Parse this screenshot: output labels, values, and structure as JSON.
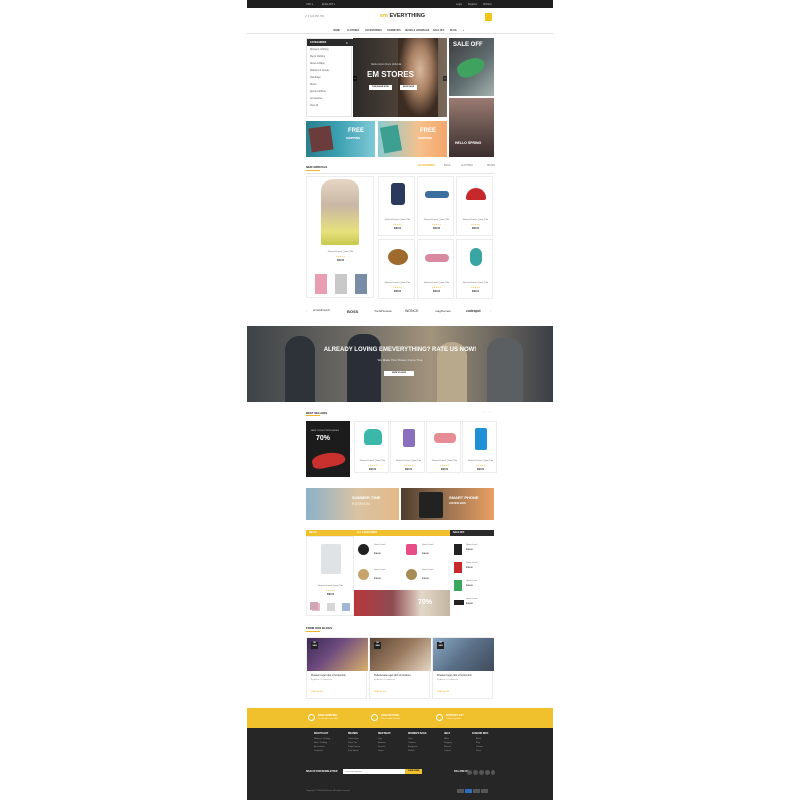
{
  "topbar": {
    "left": [
      "USD ▾",
      "ENGLISH ▾"
    ],
    "right": [
      "Login",
      "Register",
      "Wishlist"
    ]
  },
  "header": {
    "phone": "✆ 0 123 456 789",
    "logo_mark": "em",
    "logo_text": "EVERYTHING"
  },
  "nav": {
    "items": [
      "HOME",
      "CLOTHING",
      "ACCESSORIES",
      "COSMETICS",
      "SHOES & HANDBAGS",
      "SALE OFF",
      "BLOG"
    ]
  },
  "categories": {
    "header": "CATEGORIES",
    "items": [
      "Women's Clothing",
      "Men's Clothing",
      "Shoes & Bags",
      "Watches & Jewelry",
      "Handbags",
      "Shoes",
      "Sports Clothing",
      "Accessories",
      "View All"
    ]
  },
  "hero": {
    "subtitle": "Nulla rutrum Nunc Vehicula",
    "title": "EM STORES",
    "btn1": "PURCHASE NOW",
    "btn2": "SHOP NOW"
  },
  "sale_banner": {
    "title": "SALE OFF"
  },
  "man_banner": {
    "title": "HELLO SPRING"
  },
  "free_banners": [
    {
      "title": "FREE",
      "subtitle": "SHIPPING"
    },
    {
      "title": "FREE",
      "subtitle": "SHIPPING"
    }
  ],
  "new_arrivals": {
    "title": "NEW ARRIVALS",
    "tabs": [
      "ACCESSORIES",
      "BAGS",
      "CLOTHING",
      "SHOES"
    ],
    "featured": {
      "name": "Nostrud Lunch Quam Title",
      "price": "$38.00"
    },
    "products": [
      {
        "name": "Nostrud Lunch Quam Title",
        "price": "$38.00"
      },
      {
        "name": "Nostrud Lunch Quam Title",
        "price": "$38.00"
      },
      {
        "name": "Nostrud Lunch Quam Title",
        "price": "$38.00"
      },
      {
        "name": "Nostrud Lunch Quam Title",
        "price": "$38.00"
      },
      {
        "name": "Nostrud Lunch Quam Title",
        "price": "$38.00"
      },
      {
        "name": "Nostrud Lunch Quam Title",
        "price": "$38.00"
      }
    ]
  },
  "brands": [
    "arrows&rounds",
    "BOSS",
    "TrendSenses",
    "WONCE",
    "magthemes",
    "codespot"
  ],
  "rate_banner": {
    "title": "ALREADY LOVING EMEVERYTHING? RATE US NOW!",
    "subtitle": "We Make Your Dream Come True",
    "button": "RATE US NOW"
  },
  "best_sellers": {
    "title": "BEST SELLERS",
    "promo_text": "NEW COLLECTION SHOES",
    "promo_pct": "70%",
    "products": [
      {
        "name": "Nostrud Lunch Quam Title",
        "price": "$38.00"
      },
      {
        "name": "Nostrud Lunch Quam Title",
        "price": "$38.00"
      },
      {
        "name": "Nostrud Lunch Quam Title",
        "price": "$38.00"
      },
      {
        "name": "Nostrud Lunch Quam Title",
        "price": "$38.00"
      }
    ]
  },
  "mid_banners": [
    {
      "title": "SUMMER TIME",
      "subtitle": "FASHION"
    },
    {
      "title": "SMART PHONE",
      "subtitle": "COVER BOX"
    }
  ],
  "deals": {
    "tab1": "DEALS",
    "tab2": "ALL CATEGORIES",
    "tab3": "SALE OFF",
    "featured": {
      "name": "Nostrud Lunch Quam Title",
      "price": "$38.00"
    },
    "grid": [
      {
        "name": "Quam Lunch",
        "price": "$38.00"
      },
      {
        "name": "Quam Lunch",
        "price": "$38.00"
      },
      {
        "name": "Quam Lunch",
        "price": "$38.00"
      },
      {
        "name": "Quam Lunch",
        "price": "$38.00"
      }
    ],
    "sale_banner_pct": "70%",
    "sale_list": [
      {
        "name": "Quam Lunch",
        "price": "$38.00"
      },
      {
        "name": "Quam Lunch",
        "price": "$38.00"
      },
      {
        "name": "Quam Lunch",
        "price": "$38.00"
      },
      {
        "name": "Quam Lunch",
        "price": "$38.00"
      }
    ]
  },
  "blog": {
    "title": "FROM OUR BLOGS",
    "posts": [
      {
        "day": "26",
        "mon": "JAN",
        "title": "Praesent eget odio ut fermentum",
        "by": "By Admin / 0 comments",
        "more": "READ MORE"
      },
      {
        "day": "26",
        "mon": "JAN",
        "title": "Pellentesque eget nibh ut tincidunt",
        "by": "By Admin / 0 comments",
        "more": "READ MORE"
      },
      {
        "day": "26",
        "mon": "JAN",
        "title": "Praesent eget odio ut fermentum",
        "by": "By Admin / 0 comments",
        "more": "READ MORE"
      }
    ]
  },
  "services": [
    {
      "title": "FREE SHIPPING",
      "sub": "On all orders over $99"
    },
    {
      "title": "FREE RETURN",
      "sub": "Return within 30 days"
    },
    {
      "title": "SUPPORT 24/7",
      "sub": "Call us any time"
    }
  ],
  "footer": {
    "columns": [
      {
        "title": "WHAT'S HOT",
        "items": [
          "Women's Clothing",
          "Men's Clothing",
          "Accessories",
          "Cosmetics"
        ]
      },
      {
        "title": "BRANDS",
        "items": [
          "Calvin Klein",
          "Dolce Vita",
          "Ralph Lauren",
          "Kate Spade"
        ]
      },
      {
        "title": "NEW SHOP",
        "items": [
          "Tops",
          "Bottoms",
          "Dresses",
          "Shoes"
        ]
      },
      {
        "title": "WOMEN'S BAGS",
        "items": [
          "Totes",
          "Clutches",
          "Backpacks",
          "Wallets"
        ]
      },
      {
        "title": "HELP",
        "items": [
          "FAQs",
          "Shipping",
          "Returns",
          "Contact"
        ]
      },
      {
        "title": "FASHION INFO",
        "items": [
          "About",
          "Blog",
          "Careers",
          "Press"
        ]
      }
    ],
    "newsletter_label": "SIGN UP FOR NEWSLETTER",
    "newsletter_placeholder": "Your email address",
    "newsletter_button": "SUBSCRIBE",
    "follow_label": "FOLLOW US",
    "copyright": "Copyright © 2016 EmThemes. All rights reserved."
  }
}
